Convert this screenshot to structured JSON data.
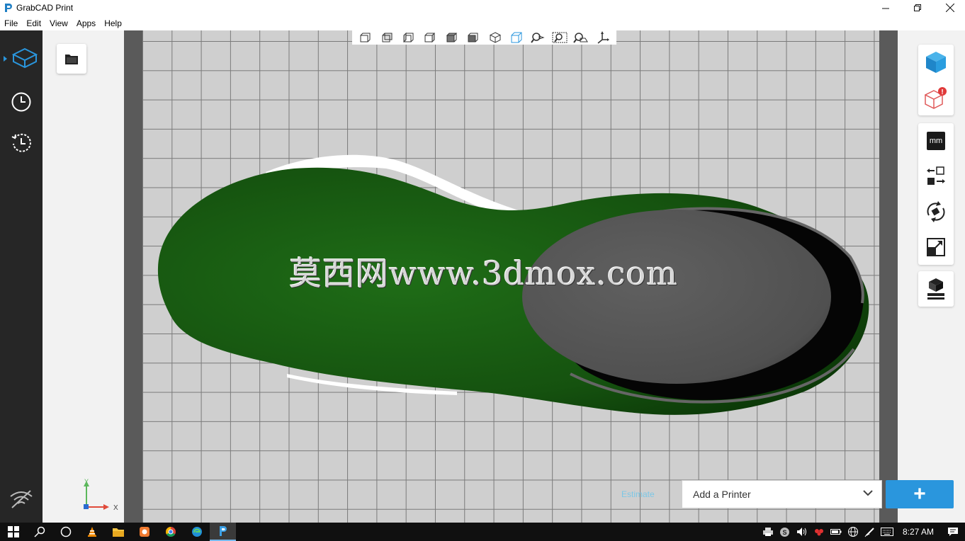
{
  "window": {
    "title": "GrabCAD Print",
    "controls": [
      "minimize",
      "maximize",
      "close"
    ]
  },
  "menu": {
    "items": [
      "File",
      "Edit",
      "View",
      "Apps",
      "Help"
    ]
  },
  "left_nav": {
    "items": [
      {
        "icon": "model-cube-icon",
        "active": true
      },
      {
        "icon": "clock-icon",
        "active": false
      },
      {
        "icon": "history-icon",
        "active": false
      }
    ],
    "bottom_icon": "wifi-off-icon"
  },
  "view_toolbar": {
    "icons": [
      "view-front-icon",
      "view-back-icon",
      "view-left-icon",
      "view-right-icon",
      "view-top-icon",
      "view-bottom-icon",
      "view-iso-icon",
      "view-fit-icon",
      "zoom-selection-icon",
      "zoom-region-icon",
      "zoom-plane-icon",
      "axis-icon"
    ]
  },
  "right_panel": {
    "group1": [
      "model-view-icon",
      "model-error-icon"
    ],
    "units_label": "mm",
    "group2": [
      "move-icon",
      "rotate-icon",
      "scale-icon"
    ],
    "group3": [
      "print-settings-icon"
    ]
  },
  "bottom": {
    "estimate_label": "Estimate",
    "printer_placeholder": "Add a Printer",
    "add_label": "+"
  },
  "axis": {
    "x_label": "X",
    "y_label": "Y"
  },
  "watermark": "莫西网www.3dmox.com",
  "taskbar": {
    "time": "8:27 AM"
  },
  "colors": {
    "model_green": "#1a5a12",
    "model_gray": "#555555",
    "accent": "#2a96dd",
    "nav_bg": "#262626"
  }
}
